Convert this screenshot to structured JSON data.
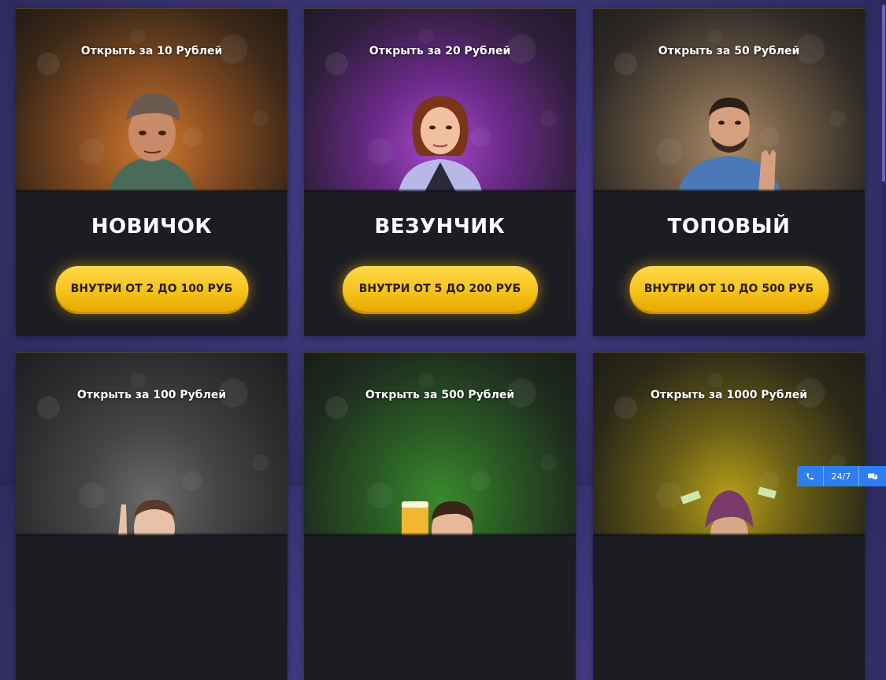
{
  "cards": [
    {
      "open_label": "Открыть за 10 Рублей",
      "title": "НОВИЧОК",
      "button": "ВНУТРИ ОТ 2 ДО 100 РУБ",
      "theme": "#b3662a"
    },
    {
      "open_label": "Открыть за 20 Рублей",
      "title": "ВЕЗУНЧИК",
      "button": "ВНУТРИ ОТ 5 ДО 200 РУБ",
      "theme": "#8a3aa8"
    },
    {
      "open_label": "Открыть за 50 Рублей",
      "title": "ТОПОВЫЙ",
      "button": "ВНУТРИ ОТ 10 ДО 500 РУБ",
      "theme": "#8a6a44"
    },
    {
      "open_label": "Открыть за 100 Рублей",
      "title": "",
      "button": "",
      "theme": "#4a4a4a"
    },
    {
      "open_label": "Открыть за 500 Рублей",
      "title": "",
      "button": "",
      "theme": "#2f6a2a"
    },
    {
      "open_label": "Открыть за 1000 Рублей",
      "title": "",
      "button": "",
      "theme": "#6a6010"
    }
  ],
  "support": {
    "hours": "24/7",
    "phone_icon": "phone-icon",
    "chat_icon": "chat-icon"
  },
  "colors": {
    "accent": "#f5c31c",
    "support_blue": "#2f7ef0"
  }
}
